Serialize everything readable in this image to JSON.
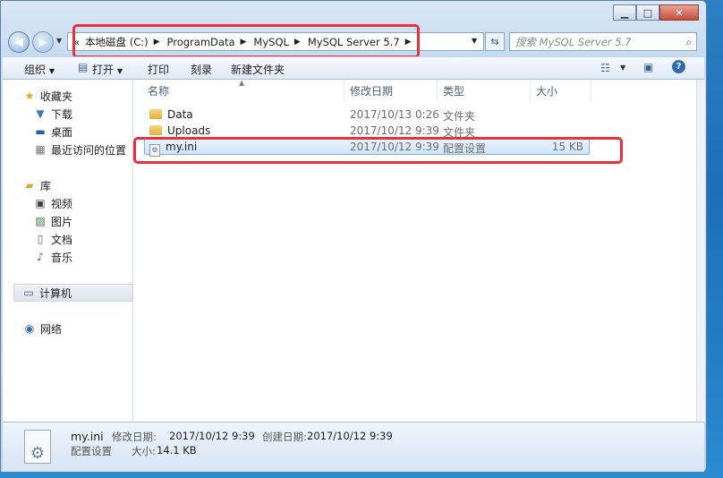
{
  "address": {
    "prefix": "«",
    "segments": [
      "本地磁盘 (C:)",
      "ProgramData",
      "MySQL",
      "MySQL Server 5.7"
    ]
  },
  "search": {
    "placeholder": "搜索 MySQL Server 5.7"
  },
  "toolbar": {
    "organize": "组织",
    "open": "打开",
    "print": "打印",
    "burn": "刻录",
    "new_folder": "新建文件夹"
  },
  "sidebar": {
    "favorites": "收藏夹",
    "downloads": "下载",
    "desktop": "桌面",
    "recent": "最近访问的位置",
    "libraries": "库",
    "videos": "视频",
    "pictures": "图片",
    "documents": "文档",
    "music": "音乐",
    "computer": "计算机",
    "network": "网络"
  },
  "columns": {
    "name": "名称",
    "modified": "修改日期",
    "type": "类型",
    "size": "大小"
  },
  "files": [
    {
      "name": "Data",
      "modified": "2017/10/13 0:26",
      "type": "文件夹",
      "size": ""
    },
    {
      "name": "Uploads",
      "modified": "2017/10/12 9:39",
      "type": "文件夹",
      "size": ""
    },
    {
      "name": "my.ini",
      "modified": "2017/10/12 9:39",
      "type": "配置设置",
      "size": "15 KB"
    }
  ],
  "details": {
    "filename": "my.ini",
    "modified_label": "修改日期:",
    "modified_value": "2017/10/12 9:39",
    "created_label": "创建日期:",
    "created_value": "2017/10/12 9:39",
    "type": "配置设置",
    "size_label": "大小:",
    "size_value": "14.1 KB"
  },
  "colors": {
    "highlight": "#e8303f",
    "selection": "#cfe4fa"
  }
}
